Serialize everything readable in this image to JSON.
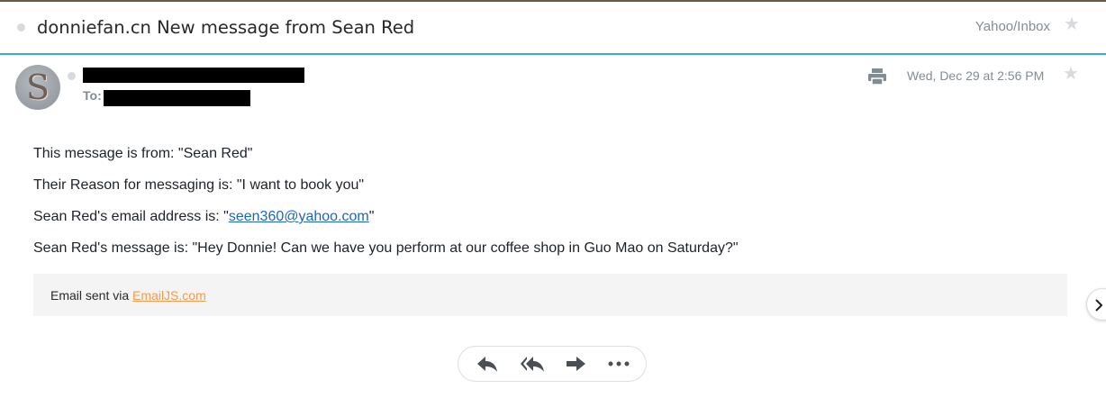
{
  "subject": {
    "title": "donniefan.cn New message from Sean Red",
    "folder": "Yahoo/Inbox"
  },
  "header": {
    "to_label": "To:",
    "date": "Wed, Dec 29 at 2:56 PM",
    "avatar_letter": "S"
  },
  "body": {
    "line1": "This message is from: \"Sean Red\"",
    "line2": "Their Reason for messaging is: \"I want to book you\"",
    "line3_prefix": "Sean Red's email address is: \"",
    "line3_email": "seen360@yahoo.com",
    "line3_suffix": "\"",
    "line4": "Sean Red's message is: \"Hey Donnie! Can we have you perform at our coffee shop in Guo Mao on Saturday?\""
  },
  "footer": {
    "prefix": "Email sent via ",
    "link": "EmailJS.com"
  },
  "icons": {
    "star": "star-icon",
    "print": "print-icon",
    "reply": "reply-icon",
    "reply_all": "reply-all-icon",
    "forward": "forward-icon",
    "more": "more-icon",
    "next": "chevron-right-icon"
  },
  "colors": {
    "accent_blue": "#39a9e6",
    "link_blue": "#1a66c5",
    "link_orange": "#f79a4c",
    "muted_text": "#828c93"
  }
}
